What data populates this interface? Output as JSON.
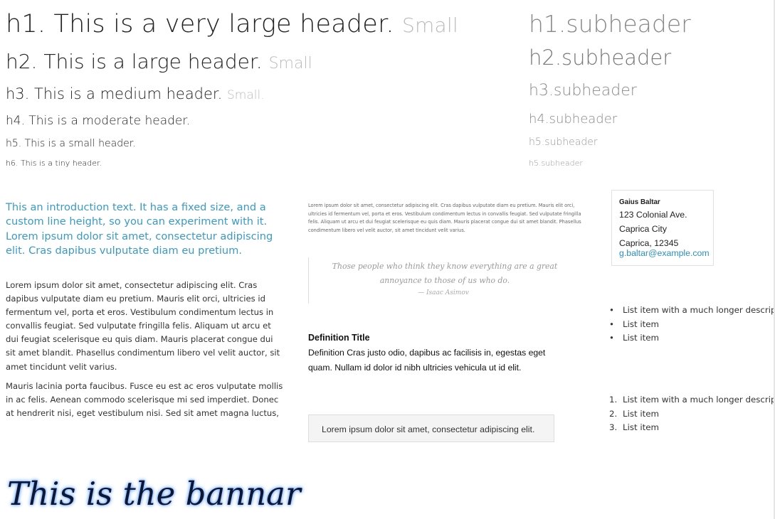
{
  "headers": {
    "h1": {
      "text": "h1. This is a very large header.",
      "small": "Small"
    },
    "h2": {
      "text": "h2. This is a large header.",
      "small": "Small"
    },
    "h3": {
      "text": "h3. This is a medium header.",
      "small": "Small."
    },
    "h4": "h4. This is a moderate header.",
    "h5": "h5. This is a small header.",
    "h6": "h6. This is a tiny header."
  },
  "subheaders": [
    "h1.subheader",
    "h2.subheader",
    "h3.subheader",
    "h4.subheader",
    "h5.subheader",
    "h5.subheader"
  ],
  "intro": "This an introduction text. It has a fixed size, and a custom line height, so you can experiment with it. Lorem ipsum dolor sit amet, consectetur adipiscing elit. Cras dapibus vulputate diam eu pretium.",
  "paragraphs": [
    "Lorem ipsum dolor sit amet, consectetur adipiscing elit. Cras dapibus vulputate diam eu pretium. Mauris elit orci, ultricies id fermentum vel, porta et eros. Vestibulum condimentum lectus in convallis feugiat. Sed vulputate fringilla felis. Aliquam ut arcu et dui feugiat scelerisque eu quis diam. Mauris placerat congue dui sit amet blandit. Phasellus condimentum libero vel velit auctor, sit amet tincidunt velit varius.",
    "Mauris lacinia porta faucibus. Fusce eu est ac eros vulputate mollis in ac felis. Aenean commodo scelerisque mi sed imperdiet. Donec at hendrerit nisi, eget vestibulum nisi. Sed sit amet magna luctus,"
  ],
  "fine_print": "Lorem ipsum dolor sit amet, consectetur adipiscing elit. Cras dapibus vulputate diam eu pretium. Mauris elit orci, ultricies id fermentum vel, porta et eros. Vestibulum condimentum lectus in convallis feugiat. Sed vulputate fringilla felis. Aliquam ut arcu et dui feugiat scelerisque eu quis diam. Mauris placerat congue dui sit amet blandit. Phasellus condimentum libero vel velit auctor, sit amet tincidunt velit varius.",
  "quote": {
    "text": "Those people who think they know everything are a great annoyance to those of us who do.",
    "cite": "— Isaac Asimov"
  },
  "definition": {
    "title": "Definition Title",
    "body": "Definition Cras justo odio, dapibus ac facilisis in, egestas eget quam. Nullam id dolor id nibh ultricies vehicula ut id elit."
  },
  "box_text": "Lorem ipsum dolor sit amet, consectetur adipiscing elit.",
  "address": {
    "name": "Gaius Baltar",
    "street": "123 Colonial Ave.",
    "city": "Caprica City",
    "city_zip": "Caprica, 12345",
    "email": "g.baltar@example.com"
  },
  "unordered_list": {
    "marker": "•",
    "items": [
      "List item with a much longer description",
      "List item",
      "List item"
    ]
  },
  "ordered_list": {
    "markers": [
      "1.",
      "2.",
      "3."
    ],
    "items": [
      "List item with a much longer description",
      "List item",
      "List item"
    ]
  },
  "banner": "This is the bannar",
  "colors": {
    "intro": "#3a9ac6",
    "link": "#2a8fc0",
    "banner_glow": "#5fa0ff"
  }
}
